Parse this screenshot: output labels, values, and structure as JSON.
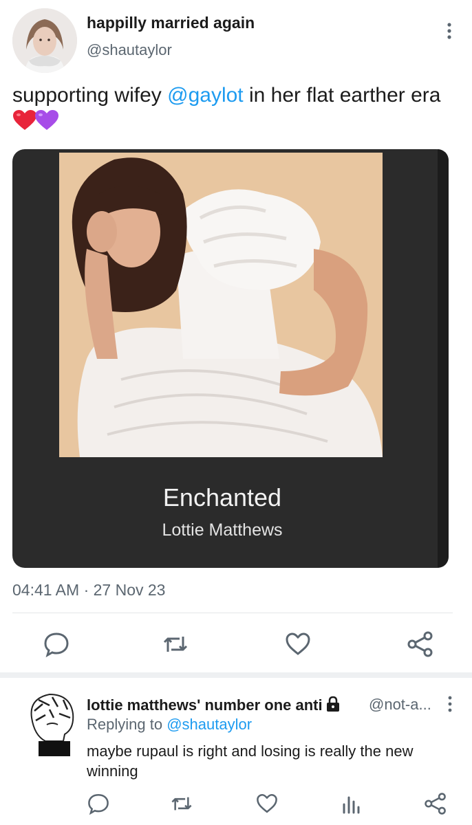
{
  "tweet": {
    "author": {
      "display_name": "happilly married again",
      "handle": "@shautaylor"
    },
    "text_before": "supporting wifey ",
    "mention": "@gaylot",
    "text_after": " in her flat earther era",
    "emoji": [
      "red-heart",
      "purple-heart"
    ],
    "media": {
      "title": "Enchanted",
      "artist": "Lottie Matthews"
    },
    "timestamp": "04:41 AM · 27 Nov 23",
    "actions": [
      "reply-icon",
      "retweet-icon",
      "like-icon",
      "share-icon"
    ]
  },
  "reply": {
    "display_name": "lottie matthews' number one anti",
    "handle": "@not-a...",
    "replying_label": "Replying to ",
    "replying_handle": "@shautaylor",
    "text": "maybe rupaul is right and losing is really the new winning",
    "actions": [
      "reply-icon",
      "retweet-icon",
      "like-icon",
      "analytics-icon",
      "share-icon"
    ]
  },
  "colors": {
    "accent": "#1d9bf0",
    "secondary_text": "#5b6670",
    "card_bg": "#2b2b2b",
    "heart_red": "#e8243a",
    "heart_purple": "#a74de8"
  }
}
